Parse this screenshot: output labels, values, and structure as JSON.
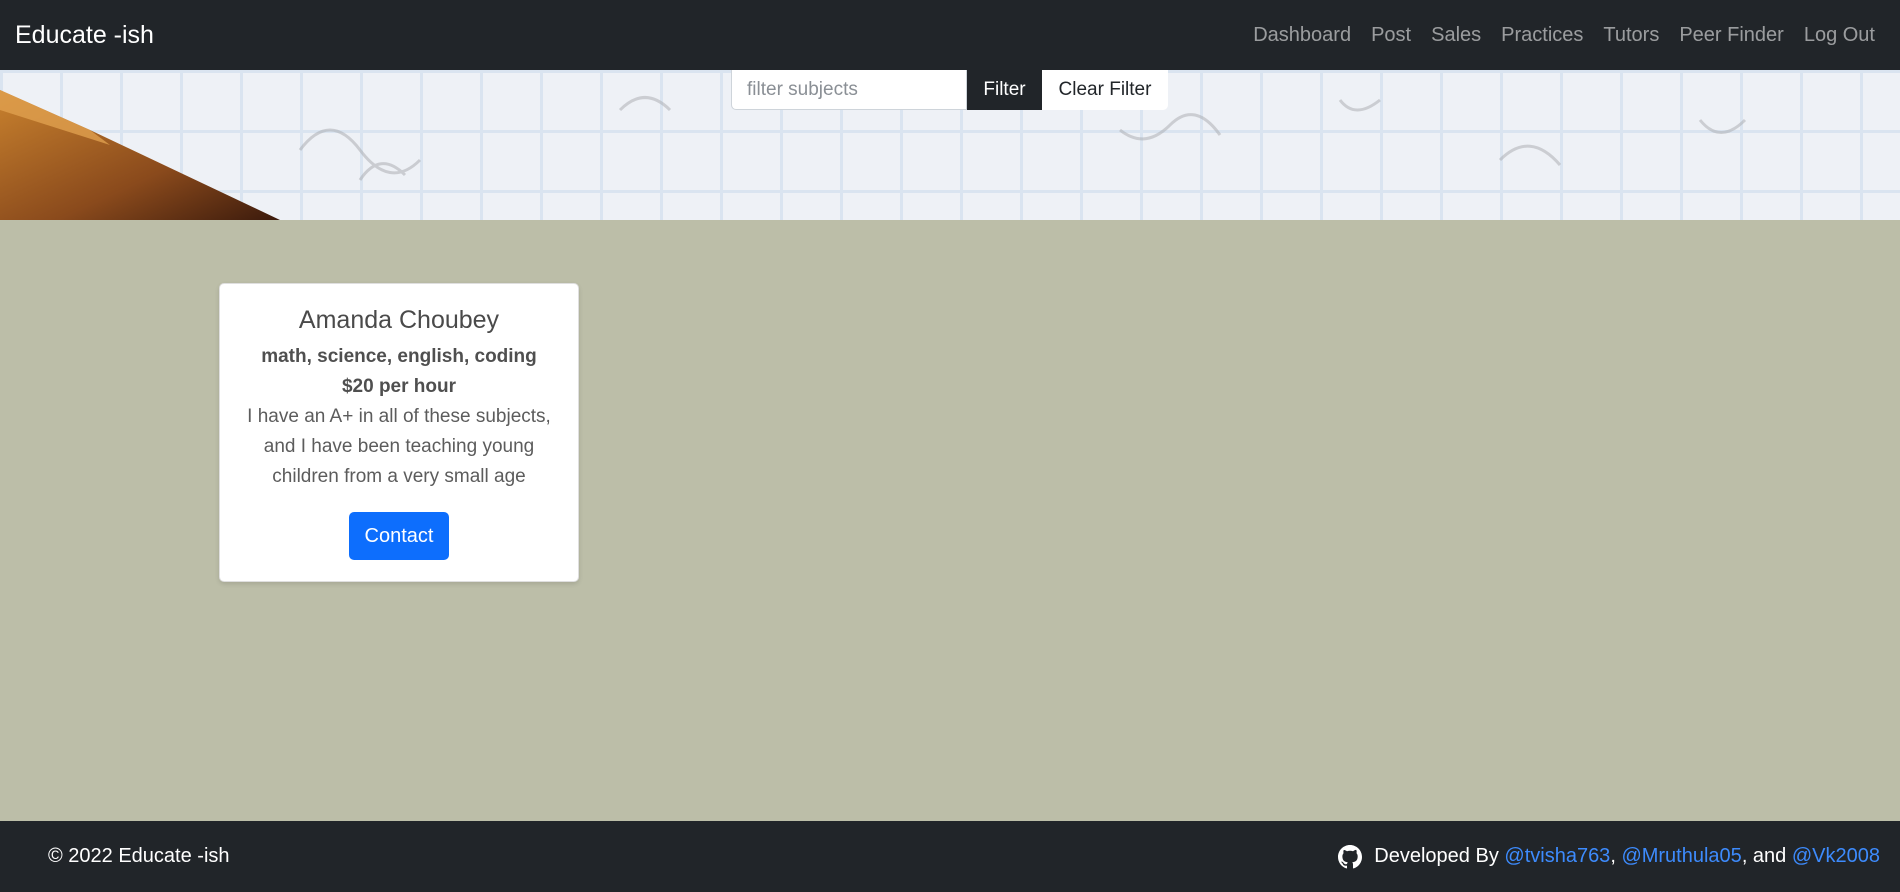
{
  "navbar": {
    "brand": "Educate -ish",
    "links": [
      "Dashboard",
      "Post",
      "Sales",
      "Practices",
      "Tutors",
      "Peer Finder",
      "Log Out"
    ]
  },
  "filter": {
    "placeholder": "filter subjects",
    "value": "",
    "filter_label": "Filter",
    "clear_label": "Clear Filter"
  },
  "tutor_card": {
    "name": "Amanda Choubey",
    "subjects": "math, science, english, coding",
    "rate": "$20 per hour",
    "bio": "I have an A+ in all of these subjects, and I have been teaching young children from a very small age",
    "contact_label": "Contact"
  },
  "footer": {
    "copyright": "© 2022 Educate -ish",
    "developed_by": "Developed By",
    "dev1": "@tvisha763",
    "sep1": ",",
    "dev2": "@Mruthula05",
    "sep2": ", and",
    "dev3": "@Vk2008",
    "icon": "github-icon"
  },
  "colors": {
    "nav_bg": "#212529",
    "main_bg": "#bcbea8",
    "primary": "#0d6efd",
    "link": "#3d8bfd"
  }
}
